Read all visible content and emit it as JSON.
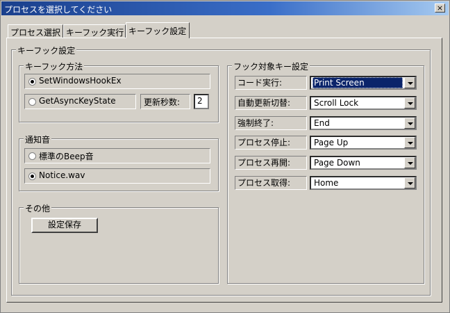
{
  "window": {
    "title": "プロセスを選択してください",
    "close_glyph": "×"
  },
  "tabs": [
    {
      "label": "プロセス選択"
    },
    {
      "label": "キーフック実行"
    },
    {
      "label": "キーフック設定"
    }
  ],
  "panel": {
    "group_title": "キーフック設定",
    "hook_method": {
      "title": "キーフック方法",
      "option1": "SetWindowsHookEx",
      "option2": "GetAsyncKeyState",
      "interval_label": "更新秒数:",
      "interval_value": "2",
      "selected": "SetWindowsHookEx"
    },
    "notify_sound": {
      "title": "通知音",
      "option1": "標準のBeep音",
      "option2": "Notice.wav",
      "selected": "Notice.wav"
    },
    "other": {
      "title": "その他",
      "save_button": "設定保存"
    },
    "hook_keys": {
      "title": "フック対象キー設定",
      "rows": [
        {
          "label": "コード実行:",
          "value": "Print Screen"
        },
        {
          "label": "自動更新切替:",
          "value": "Scroll Lock"
        },
        {
          "label": "強制終了:",
          "value": "End"
        },
        {
          "label": "プロセス停止:",
          "value": "Page Up"
        },
        {
          "label": "プロセス再開:",
          "value": "Page Down"
        },
        {
          "label": "プロセス取得:",
          "value": "Home"
        }
      ]
    }
  }
}
